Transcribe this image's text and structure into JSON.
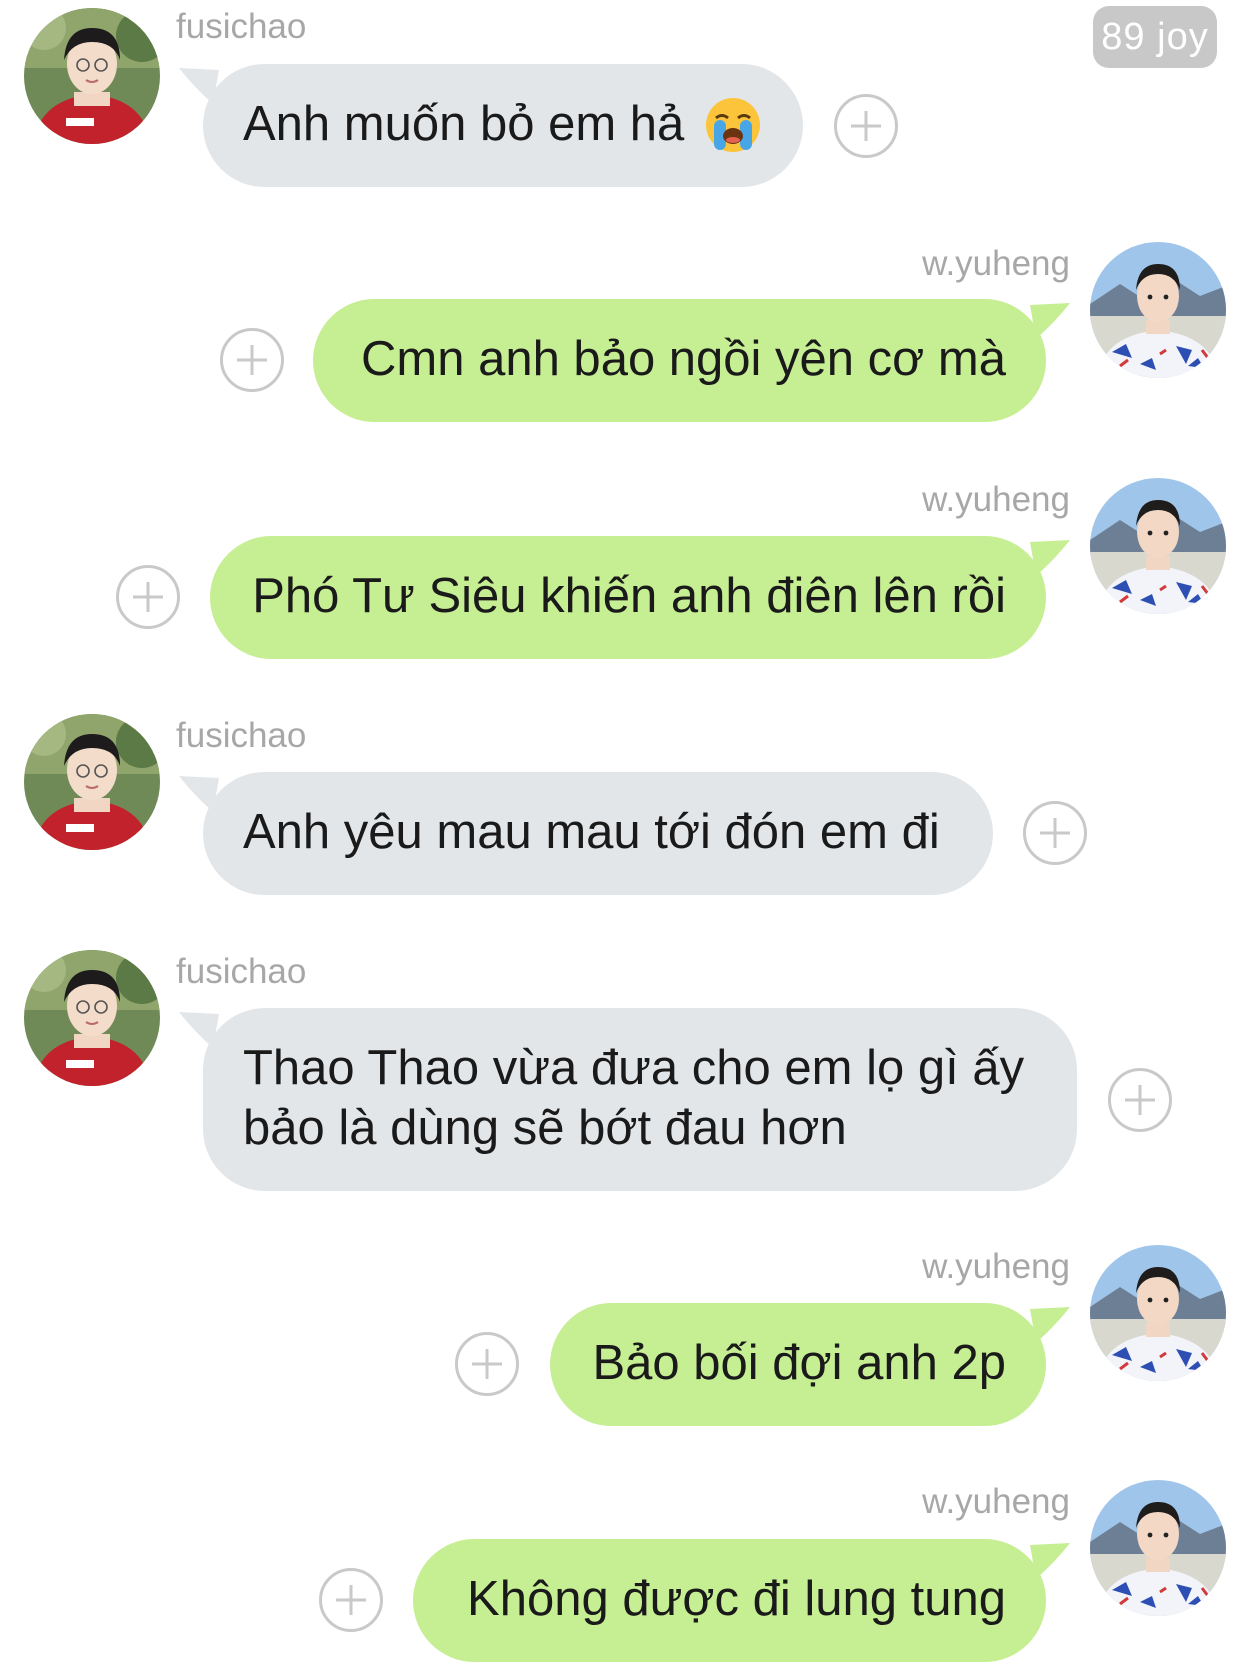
{
  "header": {
    "badge": "89 joy"
  },
  "users": {
    "fusichao": {
      "name": "fusichao",
      "avatar_icon": "avatar-red-hoodie"
    },
    "wyuheng": {
      "name": "w.yuheng",
      "avatar_icon": "avatar-floral-shirt"
    }
  },
  "colors": {
    "incoming_bubble": "#e3e6e9",
    "outgoing_bubble": "#c6ee93",
    "username": "#a7a7a7",
    "plus_icon": "#c9c9c9"
  },
  "messages": [
    {
      "sender": "fusichao",
      "direction": "incoming",
      "text": "Anh muốn bỏ em hả",
      "emoji": "loudly-crying-face"
    },
    {
      "sender": "w.yuheng",
      "direction": "outgoing",
      "text": "Cmn anh bảo ngồi yên cơ mà"
    },
    {
      "sender": "w.yuheng",
      "direction": "outgoing",
      "text": "Phó Tư Siêu khiến anh điên lên rồi"
    },
    {
      "sender": "fusichao",
      "direction": "incoming",
      "text": "Anh yêu mau mau tới đón em đi"
    },
    {
      "sender": "fusichao",
      "direction": "incoming",
      "text": "Thao Thao vừa đưa cho em lọ gì ấy\nbảo là dùng sẽ bớt đau hơn"
    },
    {
      "sender": "w.yuheng",
      "direction": "outgoing",
      "text": "Bảo bối đợi anh 2p"
    },
    {
      "sender": "w.yuheng",
      "direction": "outgoing",
      "text": "Không được đi lung tung"
    }
  ]
}
